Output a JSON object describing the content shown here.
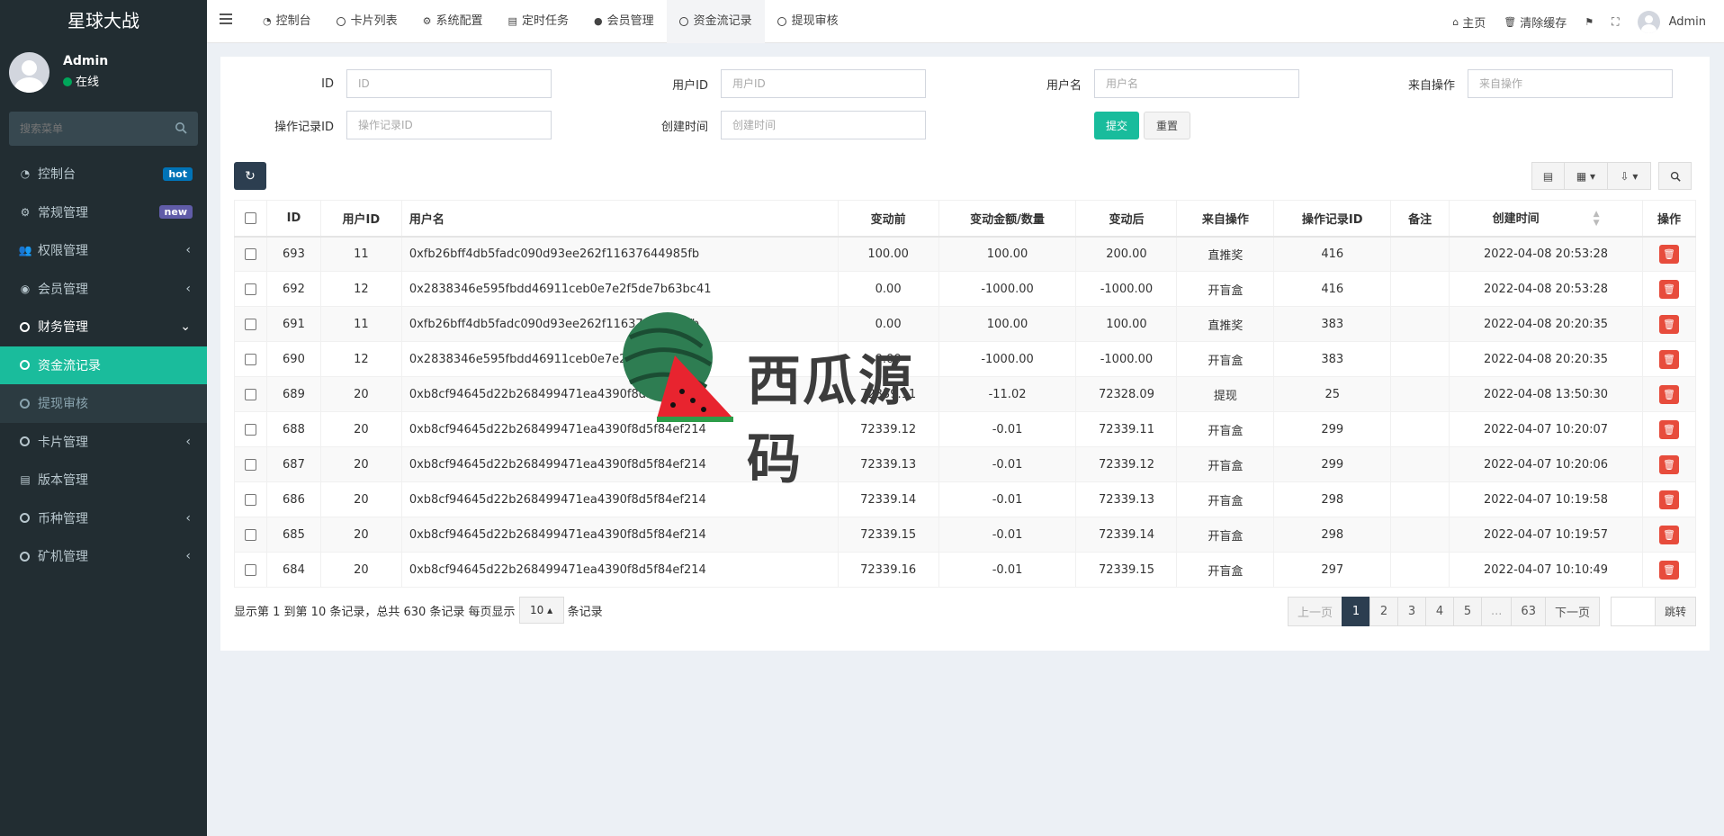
{
  "app": {
    "title": "星球大战"
  },
  "user": {
    "name": "Admin",
    "status": "在线"
  },
  "sidebar": {
    "search_placeholder": "搜索菜单",
    "items": [
      {
        "label": "控制台",
        "icon": "dashboard-icon",
        "badge": "hot",
        "badge_color": "#0073b7"
      },
      {
        "label": "常规管理",
        "icon": "cogs-icon",
        "badge": "new",
        "badge_color": "#605ca8"
      },
      {
        "label": "权限管理",
        "icon": "group-icon",
        "arrow": "‹"
      },
      {
        "label": "会员管理",
        "icon": "user-circle-icon",
        "arrow": "‹"
      },
      {
        "label": "财务管理",
        "icon": "circle-icon",
        "arrow": "⌄"
      },
      {
        "label": "资金流记录",
        "icon": "circle-icon"
      },
      {
        "label": "提现审核",
        "icon": "circle-icon"
      },
      {
        "label": "卡片管理",
        "icon": "circle-icon",
        "arrow": "‹"
      },
      {
        "label": "版本管理",
        "icon": "file-icon"
      },
      {
        "label": "币种管理",
        "icon": "circle-icon",
        "arrow": "‹"
      },
      {
        "label": "矿机管理",
        "icon": "circle-icon",
        "arrow": "‹"
      }
    ]
  },
  "navbar": {
    "tabs": [
      {
        "label": "控制台",
        "icon": "dashboard-icon"
      },
      {
        "label": "卡片列表",
        "icon": "circle-icon"
      },
      {
        "label": "系统配置",
        "icon": "gear-icon"
      },
      {
        "label": "定时任务",
        "icon": "tasks-icon"
      },
      {
        "label": "会员管理",
        "icon": "user-icon"
      },
      {
        "label": "资金流记录",
        "icon": "circle-icon"
      },
      {
        "label": "提现审核",
        "icon": "circle-icon"
      }
    ],
    "right": {
      "home": "主页",
      "clear_cache": "清除缓存",
      "admin": "Admin"
    }
  },
  "filters": {
    "id_label": "ID",
    "id_placeholder": "ID",
    "user_id_label": "用户ID",
    "user_id_placeholder": "用户ID",
    "username_label": "用户名",
    "username_placeholder": "用户名",
    "source_label": "来自操作",
    "source_placeholder": "来自操作",
    "op_id_label": "操作记录ID",
    "op_id_placeholder": "操作记录ID",
    "created_label": "创建时间",
    "created_placeholder": "创建时间",
    "submit": "提交",
    "reset": "重置"
  },
  "table": {
    "headers": [
      "ID",
      "用户ID",
      "用户名",
      "变动前",
      "变动金额/数量",
      "变动后",
      "来自操作",
      "操作记录ID",
      "备注",
      "创建时间",
      "操作"
    ],
    "rows": [
      [
        "693",
        "11",
        "0xfb26bff4db5fadc090d93ee262f11637644985fb",
        "100.00",
        "100.00",
        "200.00",
        "直推奖",
        "416",
        "",
        "2022-04-08 20:53:28"
      ],
      [
        "692",
        "12",
        "0x2838346e595fbdd46911ceb0e7e2f5de7b63bc41",
        "0.00",
        "-1000.00",
        "-1000.00",
        "开盲盒",
        "416",
        "",
        "2022-04-08 20:53:28"
      ],
      [
        "691",
        "11",
        "0xfb26bff4db5fadc090d93ee262f11637644985fb",
        "0.00",
        "100.00",
        "100.00",
        "直推奖",
        "383",
        "",
        "2022-04-08 20:20:35"
      ],
      [
        "690",
        "12",
        "0x2838346e595fbdd46911ceb0e7e2f5de7b63bc41",
        "0.00",
        "-1000.00",
        "-1000.00",
        "开盲盒",
        "383",
        "",
        "2022-04-08 20:20:35"
      ],
      [
        "689",
        "20",
        "0xb8cf94645d22b268499471ea4390f8d5f84ef214",
        "72339.11",
        "-11.02",
        "72328.09",
        "提现",
        "25",
        "",
        "2022-04-08 13:50:30"
      ],
      [
        "688",
        "20",
        "0xb8cf94645d22b268499471ea4390f8d5f84ef214",
        "72339.12",
        "-0.01",
        "72339.11",
        "开盲盒",
        "299",
        "",
        "2022-04-07 10:20:07"
      ],
      [
        "687",
        "20",
        "0xb8cf94645d22b268499471ea4390f8d5f84ef214",
        "72339.13",
        "-0.01",
        "72339.12",
        "开盲盒",
        "299",
        "",
        "2022-04-07 10:20:06"
      ],
      [
        "686",
        "20",
        "0xb8cf94645d22b268499471ea4390f8d5f84ef214",
        "72339.14",
        "-0.01",
        "72339.13",
        "开盲盒",
        "298",
        "",
        "2022-04-07 10:19:58"
      ],
      [
        "685",
        "20",
        "0xb8cf94645d22b268499471ea4390f8d5f84ef214",
        "72339.15",
        "-0.01",
        "72339.14",
        "开盲盒",
        "298",
        "",
        "2022-04-07 10:19:57"
      ],
      [
        "684",
        "20",
        "0xb8cf94645d22b268499471ea4390f8d5f84ef214",
        "72339.16",
        "-0.01",
        "72339.15",
        "开盲盒",
        "297",
        "",
        "2022-04-07 10:10:49"
      ]
    ]
  },
  "pager": {
    "info_prefix": "显示第 1 到第 10 条记录，总共 630 条记录 每页显示",
    "page_size": "10",
    "info_suffix": "条记录",
    "prev": "上一页",
    "pages": [
      "1",
      "2",
      "3",
      "4",
      "5",
      "...",
      "63"
    ],
    "next": "下一页",
    "go": "跳转"
  },
  "watermark": {
    "text": "西瓜源码"
  },
  "colors": {
    "sidebar_bg": "#222d32",
    "active": "#1abc9c",
    "primary": "#2c3e50",
    "danger": "#e74c3c"
  }
}
